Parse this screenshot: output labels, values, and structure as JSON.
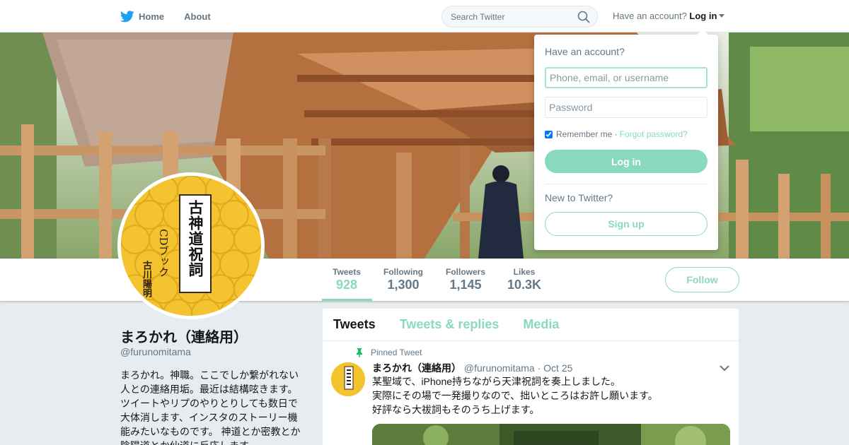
{
  "nav": {
    "home_label": "Home",
    "about_label": "About",
    "search_placeholder": "Search Twitter",
    "have_account_text": "Have an account?",
    "login_label": "Log in"
  },
  "profile": {
    "name": "まろかれ（連絡用）",
    "handle": "@furunomitama",
    "bio": "まろかれ。神職。ここでしか繋がれない人との連絡用垢。最近は結構呟きます。ツイートやリプのやりとりしても数日で大体消します、インスタのストーリー機能みたいなものです。 神道とか密教とか陰陽道とか仙道に反応します。",
    "avatar_title": "古神道祝詞",
    "avatar_subtitle": "CDブック",
    "avatar_author": "古川陽明",
    "follow_label": "Follow"
  },
  "stats": [
    {
      "label": "Tweets",
      "value": "928"
    },
    {
      "label": "Following",
      "value": "1,300"
    },
    {
      "label": "Followers",
      "value": "1,145"
    },
    {
      "label": "Likes",
      "value": "10.3K"
    }
  ],
  "timeline": {
    "tabs": [
      "Tweets",
      "Tweets & replies",
      "Media"
    ],
    "pinned_label": "Pinned Tweet",
    "tweet": {
      "author": "まろかれ（連絡用）",
      "handle": "@furunomitama",
      "date": "· Oct 25",
      "lines": [
        "某聖域で、iPhone持ちながら天津祝詞を奏上しました。",
        "実際にその場で一発撮りなので、拙いところはお許し願います。",
        "好評なら大祓詞もそのうち上げます。"
      ]
    }
  },
  "login_dropdown": {
    "title": "Have an account?",
    "username_placeholder": "Phone, email, or username",
    "password_placeholder": "Password",
    "remember_label": "Remember me",
    "separator": "·",
    "forgot_label": "Forgot password?",
    "login_button": "Log in",
    "new_text": "New to Twitter?",
    "signup_button": "Sign up"
  },
  "colors": {
    "accent": "#89d9c1",
    "twitter_blue": "#1da1f2",
    "avatar_yellow": "#f3c42f"
  }
}
